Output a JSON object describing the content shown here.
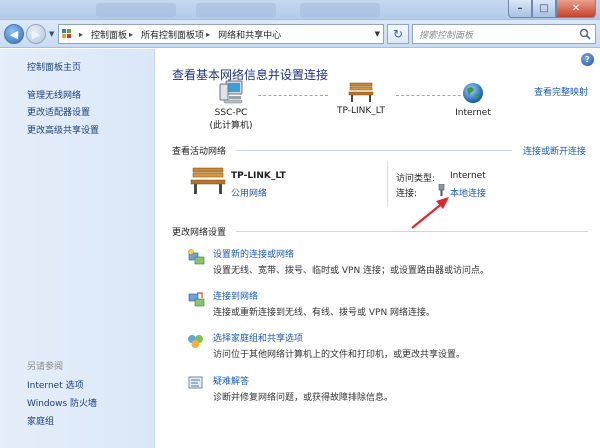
{
  "address": {
    "crumbs": [
      "控制面板",
      "所有控制面板项",
      "网络和共享中心"
    ],
    "search_placeholder": "搜索控制面板"
  },
  "sidebar": {
    "home": "控制面板主页",
    "links": [
      "管理无线网络",
      "更改适配器设置",
      "更改高级共享设置"
    ],
    "see_also_title": "另请参阅",
    "see_also": [
      "Internet 选项",
      "Windows 防火墙",
      "家庭组"
    ]
  },
  "main": {
    "title": "查看基本网络信息并设置连接",
    "full_map": "查看完整映射",
    "map": {
      "computer_name": "SSC-PC",
      "computer_sub": "(此计算机)",
      "network": "TP-LINK_LT",
      "internet": "Internet"
    },
    "active": {
      "title": "查看活动网络",
      "disconnect": "连接或断开连接",
      "name": "TP-LINK_LT",
      "type": "公用网络",
      "access_label": "访问类型:",
      "access_value": "Internet",
      "conn_label": "连接:",
      "conn_value": "本地连接"
    },
    "change": {
      "title": "更改网络设置",
      "tasks": [
        {
          "link": "设置新的连接或网络",
          "desc": "设置无线、宽带、拨号、临时或 VPN 连接；或设置路由器或访问点。"
        },
        {
          "link": "连接到网络",
          "desc": "连接或重新连接到无线、有线、拨号或 VPN 网络连接。"
        },
        {
          "link": "选择家庭组和共享选项",
          "desc": "访问位于其他网络计算机上的文件和打印机，或更改共享设置。"
        },
        {
          "link": "疑难解答",
          "desc": "诊断并修复网络问题，或获得故障排除信息。"
        }
      ]
    }
  },
  "colors": {
    "link": "#1b5bb6",
    "title": "#1e3287",
    "arrow": "#e8242b"
  }
}
